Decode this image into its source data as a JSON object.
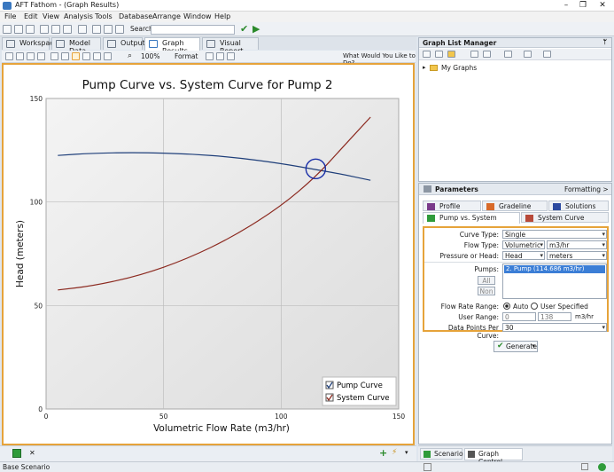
{
  "window": {
    "title": "AFT Fathom - (Graph Results)"
  },
  "menu": [
    "File",
    "Edit",
    "View",
    "Analysis",
    "Tools",
    "Database",
    "Arrange",
    "Window",
    "Help"
  ],
  "toolbar": {
    "search_placeholder": "Search"
  },
  "tabs": [
    {
      "label": "Workspace"
    },
    {
      "label": "Model Data"
    },
    {
      "label": "Output"
    },
    {
      "label": "Graph Results"
    },
    {
      "label": "Visual Report"
    }
  ],
  "graph_toolbar": {
    "zoom": "100%",
    "format": "Format",
    "help": "What Would You Like to Do?"
  },
  "graph_list": {
    "title": "Graph List Manager",
    "root": "My Graphs"
  },
  "parameters": {
    "title": "Parameters",
    "formatting": "Formatting >",
    "tabs": [
      "Profile",
      "Gradeline",
      "Solutions",
      "Pump vs. System",
      "System Curve"
    ],
    "curve_type_label": "Curve Type:",
    "curve_type": "Single",
    "flow_type_label": "Flow Type:",
    "flow_type": "Volumetric",
    "flow_unit": "m3/hr",
    "pressure_label": "Pressure or Head:",
    "pressure": "Head",
    "pressure_unit": "meters",
    "pumps_label": "Pumps:",
    "pump_item": "2. Pump (114.686 m3/hr)",
    "all": "All",
    "non": "Non",
    "flow_range_label": "Flow Rate Range:",
    "auto": "Auto",
    "user_specified": "User Specified",
    "user_range_label": "User Range:",
    "range_min": "0",
    "range_max": "138",
    "range_unit": "m3/hr",
    "points_label": "Data Points Per Curve:",
    "points": "30",
    "generate": "Generate"
  },
  "bottom_tabs": {
    "scenario": "Scenario",
    "graph_control": "Graph Control"
  },
  "status": {
    "text": "Base Scenario"
  },
  "chart_data": {
    "type": "line",
    "title": "Pump Curve vs. System Curve for Pump 2",
    "xlabel": "Volumetric Flow Rate (m3/hr)",
    "ylabel": "Head (meters)",
    "xlim": [
      0,
      150
    ],
    "ylim": [
      0,
      150
    ],
    "xticks": [
      0,
      50,
      100,
      150
    ],
    "yticks": [
      0,
      50,
      100,
      150
    ],
    "grid": true,
    "legend": "bottom-right",
    "series": [
      {
        "name": "Pump Curve",
        "color": "#1f3f7a",
        "x": [
          5,
          20,
          40,
          60,
          80,
          100,
          115,
          125,
          138
        ],
        "y": [
          122.5,
          123.6,
          123.9,
          123.3,
          121.6,
          118.6,
          115.6,
          113.6,
          110.5
        ]
      },
      {
        "name": "System Curve",
        "color": "#8c2a20",
        "x": [
          5,
          20,
          40,
          60,
          80,
          100,
          115,
          125,
          138
        ],
        "y": [
          57.5,
          59.5,
          64.5,
          72.5,
          83.5,
          98,
          112.5,
          125,
          141
        ]
      }
    ],
    "operating_point": {
      "x": 114.7,
      "y": 116
    }
  }
}
